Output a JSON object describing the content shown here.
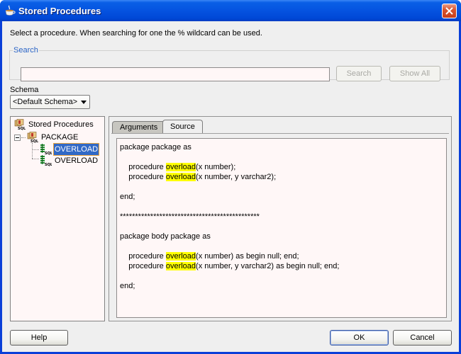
{
  "window": {
    "title": "Stored Procedures",
    "close_label": "Close"
  },
  "instruction": "Select a procedure. When searching for one the % wildcard can be used.",
  "search": {
    "group_label": "Search",
    "input_value": "",
    "search_button": "Search",
    "show_all_button": "Show All"
  },
  "schema": {
    "label": "Schema",
    "selected": "<Default Schema>"
  },
  "tree": {
    "root": "Stored Procedures",
    "package": "PACKAGE",
    "items": [
      {
        "label": "OVERLOAD",
        "selected": true
      },
      {
        "label": "OVERLOAD",
        "selected": false
      }
    ]
  },
  "tabs": [
    {
      "label": "Arguments",
      "active": false
    },
    {
      "label": "Source",
      "active": true
    }
  ],
  "source": {
    "highlight_term": "overload",
    "lines": [
      {
        "pre": "package package as",
        "hl": "",
        "post": ""
      },
      {
        "pre": "",
        "hl": "",
        "post": ""
      },
      {
        "pre": "    procedure ",
        "hl": "overload",
        "post": "(x number);"
      },
      {
        "pre": "    procedure ",
        "hl": "overload",
        "post": "(x number, y varchar2);"
      },
      {
        "pre": "",
        "hl": "",
        "post": ""
      },
      {
        "pre": "end;",
        "hl": "",
        "post": ""
      },
      {
        "pre": "",
        "hl": "",
        "post": ""
      },
      {
        "pre": "**********************************************",
        "hl": "",
        "post": ""
      },
      {
        "pre": "",
        "hl": "",
        "post": ""
      },
      {
        "pre": "package body package as",
        "hl": "",
        "post": ""
      },
      {
        "pre": "",
        "hl": "",
        "post": ""
      },
      {
        "pre": "    procedure ",
        "hl": "overload",
        "post": "(x number) as begin null; end;"
      },
      {
        "pre": "    procedure ",
        "hl": "overload",
        "post": "(x number, y varchar2) as begin null; end;"
      },
      {
        "pre": "",
        "hl": "",
        "post": ""
      },
      {
        "pre": "end;",
        "hl": "",
        "post": ""
      }
    ]
  },
  "footer": {
    "help_button": "Help",
    "ok_button": "OK",
    "cancel_button": "Cancel"
  },
  "colors": {
    "title_bar": "#0553e0",
    "highlight": "#ffff00",
    "selection": "#3169c6",
    "legend_text": "#2a64c6"
  }
}
